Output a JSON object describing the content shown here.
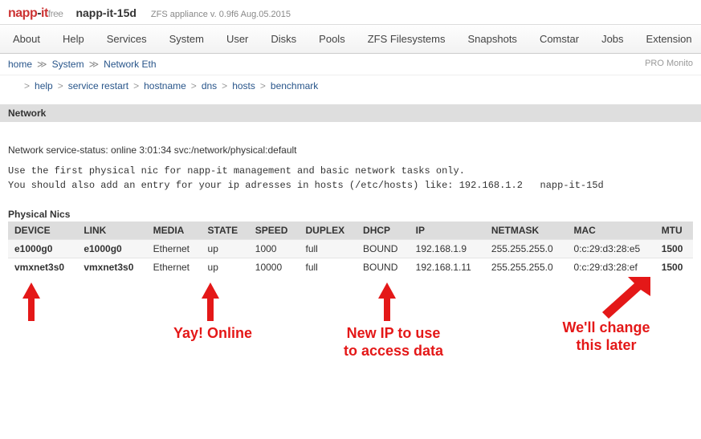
{
  "brand": {
    "logo_napp": "napp",
    "logo_dash": "-",
    "logo_it": "it",
    "free": "free",
    "hostname": "napp-it-15d",
    "version": "ZFS appliance v. 0.9f6 Aug.05.2015"
  },
  "menu": [
    "About",
    "Help",
    "Services",
    "System",
    "User",
    "Disks",
    "Pools",
    "ZFS Filesystems",
    "Snapshots",
    "Comstar",
    "Jobs",
    "Extension"
  ],
  "crumb1": {
    "items": [
      "home",
      "System",
      "Network Eth"
    ],
    "pro": "PRO Monito"
  },
  "crumb2": {
    "items": [
      "help",
      "service restart",
      "hostname",
      "dns",
      "hosts",
      "benchmark"
    ]
  },
  "section_title": "Network",
  "status_line": "Network service-status: online 3:01:34 svc:/network/physical:default",
  "mono_block": "Use the first physical nic for napp-it management and basic network tasks only.\nYou should also add an entry for your ip adresses in hosts (/etc/hosts) like: 192.168.1.2   napp-it-15d",
  "table": {
    "title": "Physical Nics",
    "headers": [
      "DEVICE",
      "LINK",
      "MEDIA",
      "STATE",
      "SPEED",
      "DUPLEX",
      "DHCP",
      "IP",
      "NETMASK",
      "MAC",
      "MTU"
    ],
    "rows": [
      {
        "device": "e1000g0",
        "link": "e1000g0",
        "media": "Ethernet",
        "state": "up",
        "speed": "1000",
        "duplex": "full",
        "dhcp": "BOUND",
        "ip": "192.168.1.9",
        "netmask": "255.255.255.0",
        "mac": "0:c:29:d3:28:e5",
        "mtu": "1500"
      },
      {
        "device": "vmxnet3s0",
        "link": "vmxnet3s0",
        "media": "Ethernet",
        "state": "up",
        "speed": "10000",
        "duplex": "full",
        "dhcp": "BOUND",
        "ip": "192.168.1.11",
        "netmask": "255.255.255.0",
        "mac": "0:c:29:d3:28:ef",
        "mtu": "1500"
      }
    ]
  },
  "annotations": {
    "a1": "",
    "a2": "Yay! Online",
    "a3": "New IP to use\nto access data",
    "a4": "We'll change\nthis later"
  }
}
